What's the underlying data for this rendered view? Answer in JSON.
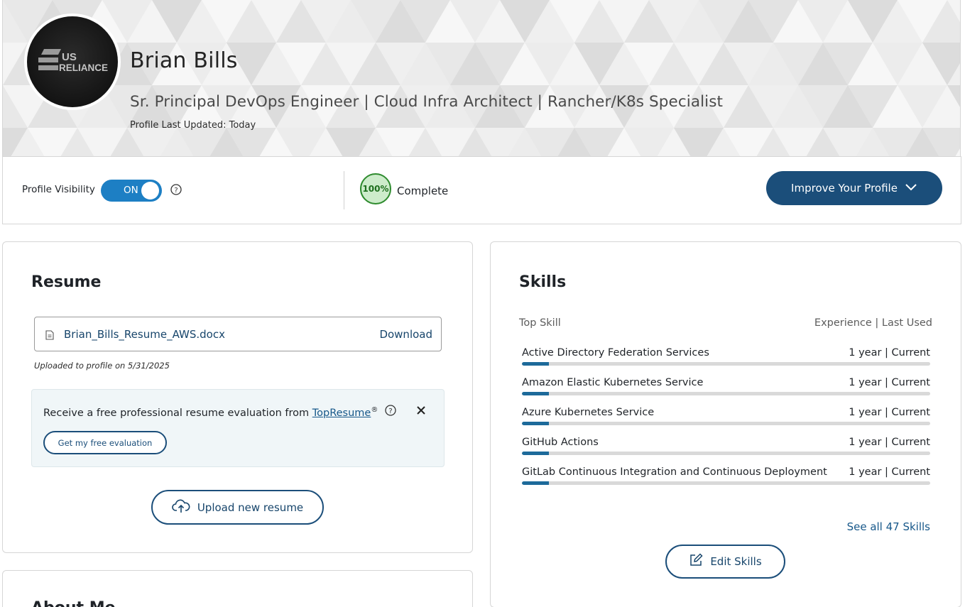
{
  "profile": {
    "avatar_logo_text": [
      "US",
      "RELIANCE"
    ],
    "name": "Brian Bills",
    "headline": "Sr. Principal DevOps Engineer | Cloud Infra Architect | Rancher/K8s Specialist",
    "last_updated": "Profile Last Updated: Today"
  },
  "visibility": {
    "label": "Profile Visibility",
    "toggle_state": "ON",
    "completeness_pct": "100%",
    "completeness_value": 1.0,
    "completeness_label": "Complete",
    "improve_button": "Improve Your Profile"
  },
  "resume": {
    "title": "Resume",
    "file_name": "Brian_Bills_Resume_AWS.docx",
    "download_label": "Download",
    "uploaded_text": "Uploaded to profile on 5/31/2025",
    "eval_text": "Receive a free professional resume evaluation from ",
    "eval_link": "TopResume",
    "eval_reg": "®",
    "eval_button": "Get my free evaluation",
    "upload_button": "Upload new resume"
  },
  "about": {
    "title": "About Me"
  },
  "skills": {
    "title": "Skills",
    "col_left": "Top Skill",
    "col_right": "Experience | Last Used",
    "items": [
      {
        "name": "Active Directory Federation Services",
        "experience": "1 year | Current",
        "level": 0.066
      },
      {
        "name": "Amazon Elastic Kubernetes Service",
        "experience": "1 year | Current",
        "level": 0.066
      },
      {
        "name": "Azure Kubernetes Service",
        "experience": "1 year | Current",
        "level": 0.066
      },
      {
        "name": "GitHub Actions",
        "experience": "1 year | Current",
        "level": 0.066
      },
      {
        "name": "GitLab Continuous Integration and Continuous Deployment",
        "experience": "1 year | Current",
        "level": 0.066
      }
    ],
    "see_all": "See all 47 Skills",
    "edit_button": "Edit Skills"
  },
  "colors": {
    "primary": "#1b4e7a",
    "toggle_on": "#1d7fc4",
    "complete_green": "#2e8b2e",
    "skill_fill": "#1d6a9a"
  }
}
